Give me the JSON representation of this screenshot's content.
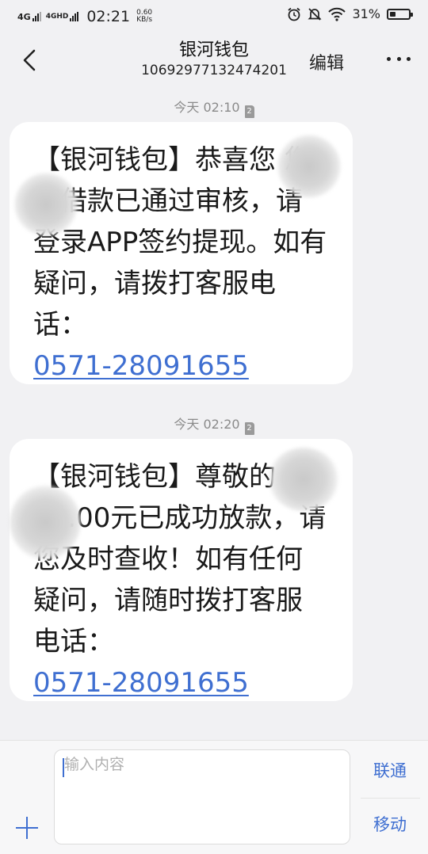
{
  "status_bar": {
    "network1": "4G",
    "network2": "4GHD",
    "time": "02:21",
    "speed_value": "0.60",
    "speed_unit": "KB/s",
    "battery": "31%",
    "battery_level": 0.31,
    "icons": [
      "alarm-icon",
      "mute-icon",
      "wifi-icon",
      "battery-icon"
    ]
  },
  "header": {
    "title": "银河钱包",
    "number": "10692977132474201",
    "edit_label": "编辑",
    "back_icon": "chevron-left-icon",
    "more_icon": "more-icon"
  },
  "messages": [
    {
      "timestamp": "今天 02:10",
      "sim": "2",
      "text": "【银河钱包】恭喜您 您的借款已通过审核，请登录APP签约提现。如有疑问，请拨打客服电话：",
      "phone": "0571-28091655"
    },
    {
      "timestamp": "今天 02:20",
      "sim": "2",
      "text": "【银河钱包】尊敬的 1000.00元已成功放款，请您及时查收！如有任何疑问，请随时拨打客服电话：",
      "phone": "0571-28091655"
    }
  ],
  "compose": {
    "placeholder": "输入内容",
    "sim1_label": "联通",
    "sim2_label": "移动",
    "add_icon": "plus-icon"
  },
  "colors": {
    "accent": "#3f6fd1",
    "background": "#f1f1f3",
    "bubble": "#ffffff"
  }
}
